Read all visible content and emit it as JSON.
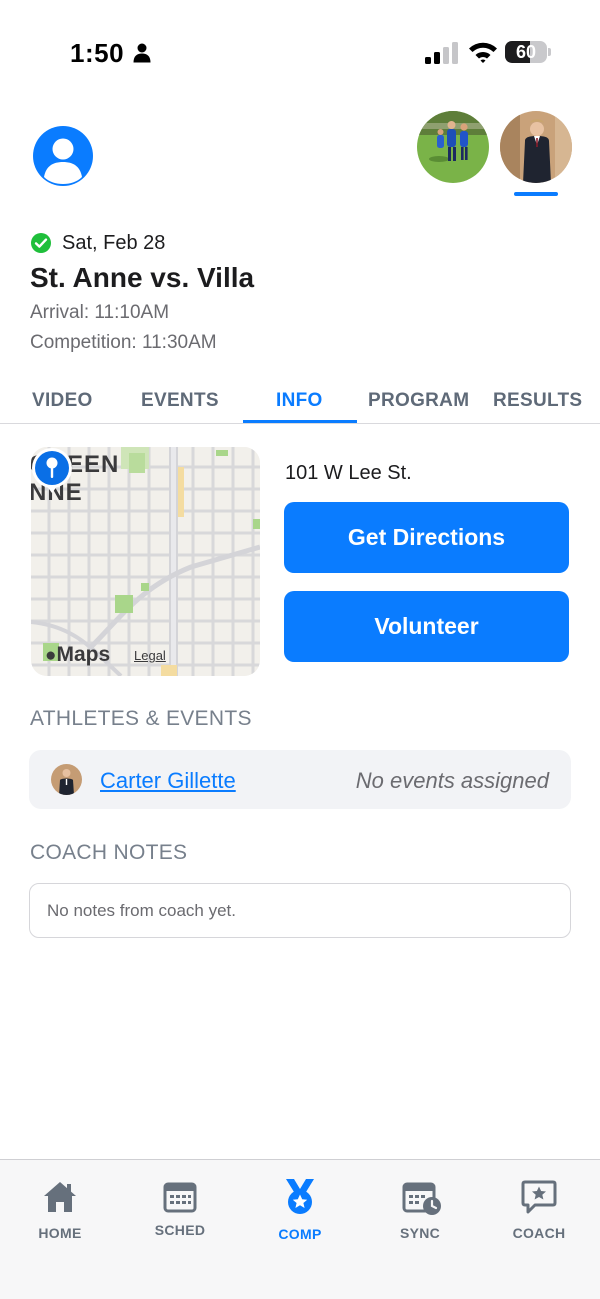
{
  "status_bar": {
    "time": "1:50",
    "battery_percent": "60",
    "battery_level": 0.6
  },
  "header": {
    "profile_icon": "person-circle-icon",
    "avatars": [
      "soccer-player-photo",
      "suited-athlete-photo"
    ],
    "accent_color": "#0a7cff"
  },
  "event": {
    "status_icon": "check-circle-icon",
    "status_color": "#1fbf3b",
    "date": "Sat, Feb 28",
    "title": "St. Anne vs. Villa",
    "arrival": "Arrival: 11:10AM",
    "competition": "Competition: 11:30AM"
  },
  "tabs": {
    "items": [
      "VIDEO",
      "EVENTS",
      "INFO",
      "PROGRAM",
      "RESULTS"
    ],
    "active": "INFO"
  },
  "location": {
    "map_labels": [
      "QUEEN",
      "NNE"
    ],
    "maps_brand": "Maps",
    "maps_legal": "Legal",
    "address": "101 W Lee St.",
    "directions_label": "Get Directions",
    "volunteer_label": "Volunteer"
  },
  "athletes": {
    "section_title": "ATHLETES & EVENTS",
    "items": [
      {
        "name": "Carter Gillette",
        "events": "No events assigned"
      }
    ]
  },
  "coach_notes": {
    "section_title": "COACH NOTES",
    "text": "No notes from coach yet."
  },
  "bottom_nav": {
    "items": [
      {
        "label": "HOME",
        "icon": "home-icon"
      },
      {
        "label": "SCHED",
        "icon": "calendar-icon"
      },
      {
        "label": "COMP",
        "icon": "medal-icon"
      },
      {
        "label": "SYNC",
        "icon": "calendar-sync-icon"
      },
      {
        "label": "COACH",
        "icon": "chat-star-icon"
      }
    ],
    "active": "COMP"
  }
}
